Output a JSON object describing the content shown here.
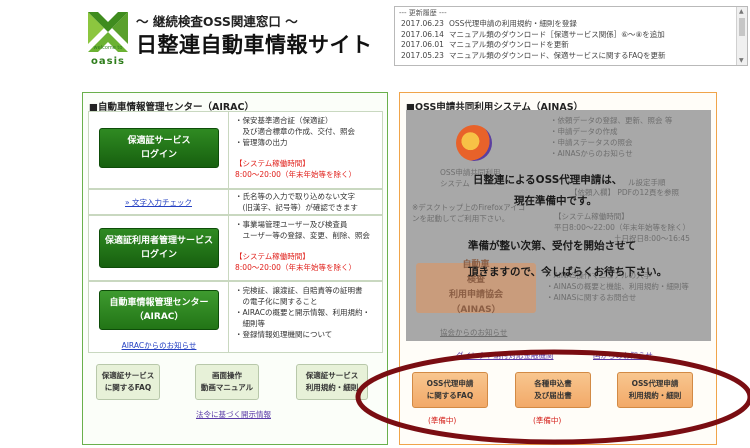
{
  "header": {
    "logo_text": "oasis",
    "sub_title": "～ 継続検査OSS関連窓口 ～",
    "site_title": "日整連自動車情報サイト"
  },
  "news": {
    "heading": "--- 更新履歴 ---",
    "items": [
      {
        "date": "2017.06.23",
        "text": "OSS代理申請の利用規約・細則を登録"
      },
      {
        "date": "2017.06.14",
        "text": "マニュアル類のダウンロード［保適サービス関係］⑥～⑧を追加"
      },
      {
        "date": "2017.06.01",
        "text": "マニュアル類のダウンロードを更新"
      },
      {
        "date": "2017.05.23",
        "text": "マニュアル類のダウンロード、保適サービスに関するFAQを更新"
      }
    ]
  },
  "airac": {
    "title": "■自動車情報管理センター（AIRAC）",
    "rows": [
      {
        "button": "保適証サービス\nログイン",
        "lines": [
          "・保安基準適合証（保適証）",
          "　及び適合標章の作成、交付、照会",
          "・管理簿の出力"
        ],
        "hours_label": "【システム稼働時間】",
        "hours": "8:00～20:00（年末年始等を除く）"
      },
      {
        "link": "» 文字入力チェック",
        "lines": [
          "・氏名等の入力で取り込めない文字",
          "　(旧漢字、記号等）が確認できます"
        ]
      },
      {
        "button": "保適証利用者管理サービス\nログイン",
        "lines": [
          "・事業場管理ユーザー及び検査員",
          "　ユーザー等の登録、変更、削除、照会"
        ],
        "hours_label": "【システム稼働時間】",
        "hours": "8:00～20:00（年末年始等を除く）"
      },
      {
        "button": "自動車情報管理センター\n（AIRAC）",
        "link": "AIRACからのお知らせ",
        "lines": [
          "・完検証、譲渡証、自賠責等の証明書",
          "　の電子化に関すること",
          "・AIRACの概要と開示情報、利用規約・",
          "　細則等",
          "・登録情報処理機関について"
        ]
      }
    ],
    "bottom_buttons": [
      "保適証サービス\nに関するFAQ",
      "画面操作\n動画マニュアル",
      "保適証サービス\n利用規約・細則"
    ],
    "disclosure_link": "法令に基づく開示情報"
  },
  "ainas": {
    "title": "■OSS申請共同利用システム（AINAS）",
    "ghost_lines": [
      "・依頼データの登録、更新、照会 等",
      "・申請データの作成",
      "・申請ステータスの照会",
      "・AINASからのお知らせ"
    ],
    "ghost_lines2": [
      "・AINAS操作マニュアルの入手",
      "・AINASの概要と機能、利用規約・細則等",
      "・AINASに関するお問合せ"
    ],
    "ghost_notice_1": "※デスクトップ上のFirefoxアイコ",
    "ghost_notice_2": "ンを起動してご利用下さい。",
    "ghost_screen_label": "OSS申請共同利用\nシステム",
    "ghost_hours_label": "【システム稼働時間】",
    "ghost_hours_1": "平日8:00～22:00（年末年始等を除く）",
    "ghost_hours_2": "土日祝日8:00～16:45",
    "ghost_manual_1": "ル設定手順",
    "ghost_manual_2": "【依頼入欄】 PDFの12頁を参照",
    "ghost_button": "自動車\n検査\n利用申請協会\n（AINAS）",
    "ghost_link": "協会からのお知らせ",
    "message": [
      "日整連によるOSS代理申請は、",
      "現在準備中です。",
      "準備が整い次第、受付を開始させて",
      "頂きますので、今しばらくお待ち下さい。"
    ],
    "links": [
      "ダイレクト納付対応金融機関",
      "国からのお知らせ"
    ],
    "buttons": [
      "OSS代理申請\nに関するFAQ",
      "各種申込書\n及び届出書",
      "OSS代理申請\n利用規約・細則"
    ],
    "status": [
      "(準備中)",
      "(準備中)"
    ]
  },
  "colors": {
    "green": "#1b6a12",
    "orange": "#f2a968",
    "red": "#d4201a",
    "ellipse": "#7a0d12"
  }
}
